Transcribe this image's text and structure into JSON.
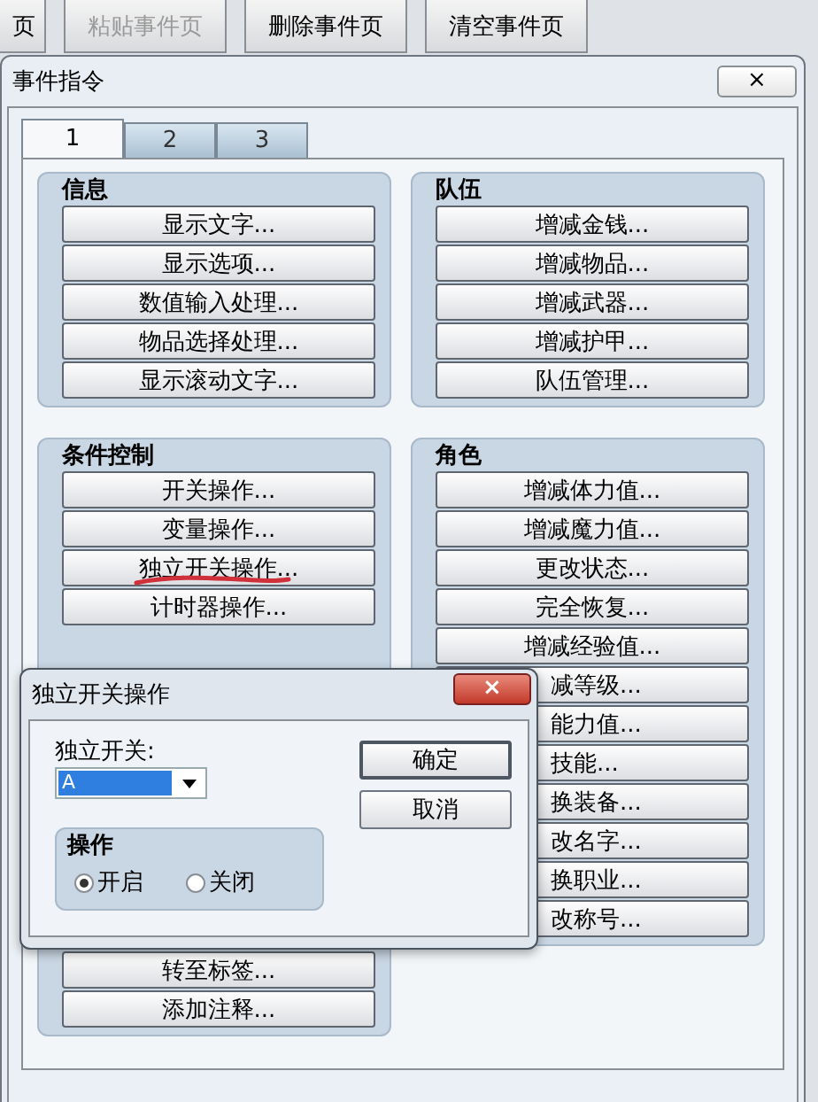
{
  "toolbar": [
    {
      "label": "页",
      "disabled": false
    },
    {
      "label": "粘贴事件页",
      "disabled": true
    },
    {
      "label": "删除事件页",
      "disabled": false
    },
    {
      "label": "清空事件页",
      "disabled": false
    }
  ],
  "window": {
    "title": "事件指令",
    "close": "×"
  },
  "tabs": [
    {
      "label": "1",
      "selected": true
    },
    {
      "label": "2",
      "selected": false
    },
    {
      "label": "3",
      "selected": false
    }
  ],
  "groups": [
    {
      "title": "信息",
      "buttons": [
        {
          "label": "显示文字..."
        },
        {
          "label": "显示选项..."
        },
        {
          "label": "数值输入处理..."
        },
        {
          "label": "物品选择处理..."
        },
        {
          "label": "显示滚动文字..."
        }
      ]
    },
    {
      "title": "队伍",
      "buttons": [
        {
          "label": "增减金钱..."
        },
        {
          "label": "增减物品..."
        },
        {
          "label": "增减武器..."
        },
        {
          "label": "增减护甲..."
        },
        {
          "label": "队伍管理..."
        }
      ]
    },
    {
      "title": "条件控制",
      "buttons": [
        {
          "label": "开关操作..."
        },
        {
          "label": "变量操作..."
        },
        {
          "label": "独立开关操作...",
          "marked": true
        },
        {
          "label": "计时器操作..."
        },
        {
          "label": "转至标签..."
        },
        {
          "label": "添加注释..."
        }
      ]
    },
    {
      "title": "角色",
      "buttons": [
        {
          "label": "增减体力值..."
        },
        {
          "label": "增减魔力值..."
        },
        {
          "label": "更改状态..."
        },
        {
          "label": "完全恢复..."
        },
        {
          "label": "增减经验值..."
        },
        {
          "label": "减等级...",
          "covered": true
        },
        {
          "label": "能力值...",
          "covered": true
        },
        {
          "label": "技能...",
          "covered": true
        },
        {
          "label": "换装备...",
          "covered": true
        },
        {
          "label": "改名字...",
          "covered": true
        },
        {
          "label": "换职业...",
          "covered": true
        },
        {
          "label": "改称号...",
          "covered": true
        }
      ]
    }
  ],
  "dialog": {
    "title": "独立开关操作",
    "close": "×",
    "switch_label": "独立开关:",
    "switch_value": "A",
    "group_title": "操作",
    "options": [
      {
        "label": "开启",
        "selected": true
      },
      {
        "label": "关闭",
        "selected": false
      }
    ],
    "buttons": [
      {
        "label": "确定",
        "default": true
      },
      {
        "label": "取消",
        "default": false
      }
    ]
  }
}
